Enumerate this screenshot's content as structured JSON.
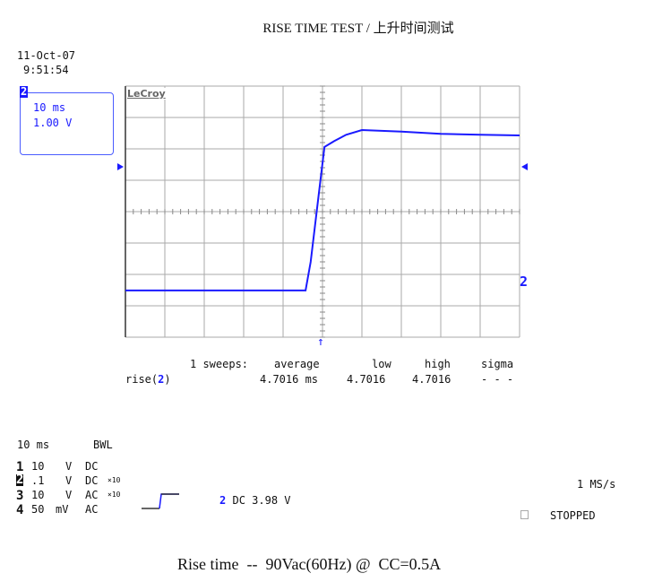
{
  "title": "RISE TIME TEST / 上升时间测试",
  "caption": "Rise time  --  90Vac(60Hz) @  CC=0.5A",
  "date": "11-Oct-07",
  "time": "9:51:54",
  "brand": "LeCroy",
  "trace_color": "#1a1aff",
  "channel_box": {
    "channel": "2",
    "timebase": "10 ms",
    "volts": "1.00 V"
  },
  "trigger_marker": "↑",
  "channel_marker": "2",
  "measurement": {
    "header": {
      "sweeps": "1 sweeps:",
      "average": "average",
      "low": "low",
      "high": "high",
      "sigma": "sigma"
    },
    "row": {
      "label": "rise(",
      "channel": "2",
      "close": ")",
      "average": "4.7016 ms",
      "low": "4.7016",
      "high": "4.7016",
      "sigma": "- - -"
    }
  },
  "setup": {
    "timebase": "10 ms",
    "bwl": "BWL",
    "channels": [
      {
        "num": "1",
        "scale": "10",
        "unit": "V",
        "coupling": "DC",
        "probe": ""
      },
      {
        "num": "2",
        "scale": ".1",
        "unit": "V",
        "coupling": "DC",
        "probe": "×10"
      },
      {
        "num": "3",
        "scale": "10",
        "unit": "V",
        "coupling": "AC",
        "probe": "×10"
      },
      {
        "num": "4",
        "scale": "50",
        "unit": "mV",
        "coupling": "AC",
        "probe": ""
      }
    ],
    "trigger": {
      "channel": "2",
      "text": "DC 3.98 V"
    },
    "sample_rate": "1 MS/s",
    "status": "STOPPED"
  },
  "chart_data": {
    "type": "line",
    "title": "",
    "xlabel": "",
    "ylabel": "",
    "x_units": "ms (10 ms/div)",
    "y_units": "V (1.00 V/div, relative to center)",
    "xlim": [
      0,
      100
    ],
    "ylim": [
      -4,
      4
    ],
    "grid": true,
    "series": [
      {
        "x": [
          0,
          20,
          45.7,
          47,
          49,
          50.5,
          53,
          56,
          60,
          70,
          80,
          90,
          100
        ],
        "y": [
          -2.51,
          -2.51,
          -2.51,
          -1.6,
          0.5,
          2.06,
          2.25,
          2.45,
          2.6,
          2.55,
          2.48,
          2.45,
          2.43
        ]
      }
    ]
  }
}
